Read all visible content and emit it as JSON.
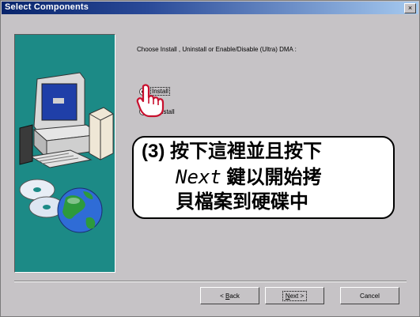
{
  "window": {
    "title": "Select Components",
    "close_glyph": "×"
  },
  "prompt": "Choose Install , Uninstall or Enable/Disable (Ultra) DMA :",
  "options": [
    {
      "label": "Install",
      "selected": true
    },
    {
      "label": "Uninstall",
      "selected": false
    }
  ],
  "callout": {
    "line1": "(3)  按下這裡並且按下",
    "line2_word": "Next",
    "line2_rest": "鍵以開始拷",
    "line3": "貝檔案到硬碟中"
  },
  "buttons": {
    "back_accel": "B",
    "back_rest": "ack",
    "back_prefix": "< ",
    "next_accel": "N",
    "next_rest": "ext",
    "next_suffix": " >",
    "cancel": "Cancel"
  },
  "colors": {
    "panel": "#1c8a86",
    "title_start": "#08246b",
    "window_bg": "#c6c3c6"
  },
  "icons": [
    "computer-illustration",
    "cd-discs-illustration",
    "globe-illustration",
    "pointing-hand-icon"
  ]
}
